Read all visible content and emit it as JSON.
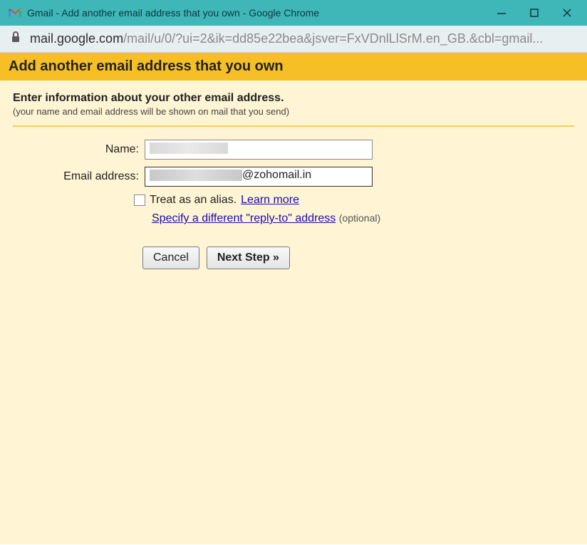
{
  "window": {
    "title": "Gmail - Add another email address that you own - Google Chrome"
  },
  "addressbar": {
    "domain": "mail.google.com",
    "path": "/mail/u/0/?ui=2&ik=dd85e22bea&jsver=FxVDnlLlSrM.en_GB.&cbl=gmail..."
  },
  "header": {
    "title": "Add another email address that you own"
  },
  "info": {
    "title": "Enter information about your other email address.",
    "subtitle": "(your name and email address will be shown on mail that you send)"
  },
  "form": {
    "name_label": "Name:",
    "email_label": "Email address:",
    "email_domain": "@zohomail.in",
    "alias_label": "Treat as an alias.",
    "learn_more": "Learn more",
    "reply_to_link": "Specify a different \"reply-to\" address",
    "optional": "(optional)"
  },
  "buttons": {
    "cancel": "Cancel",
    "next": "Next Step »"
  }
}
